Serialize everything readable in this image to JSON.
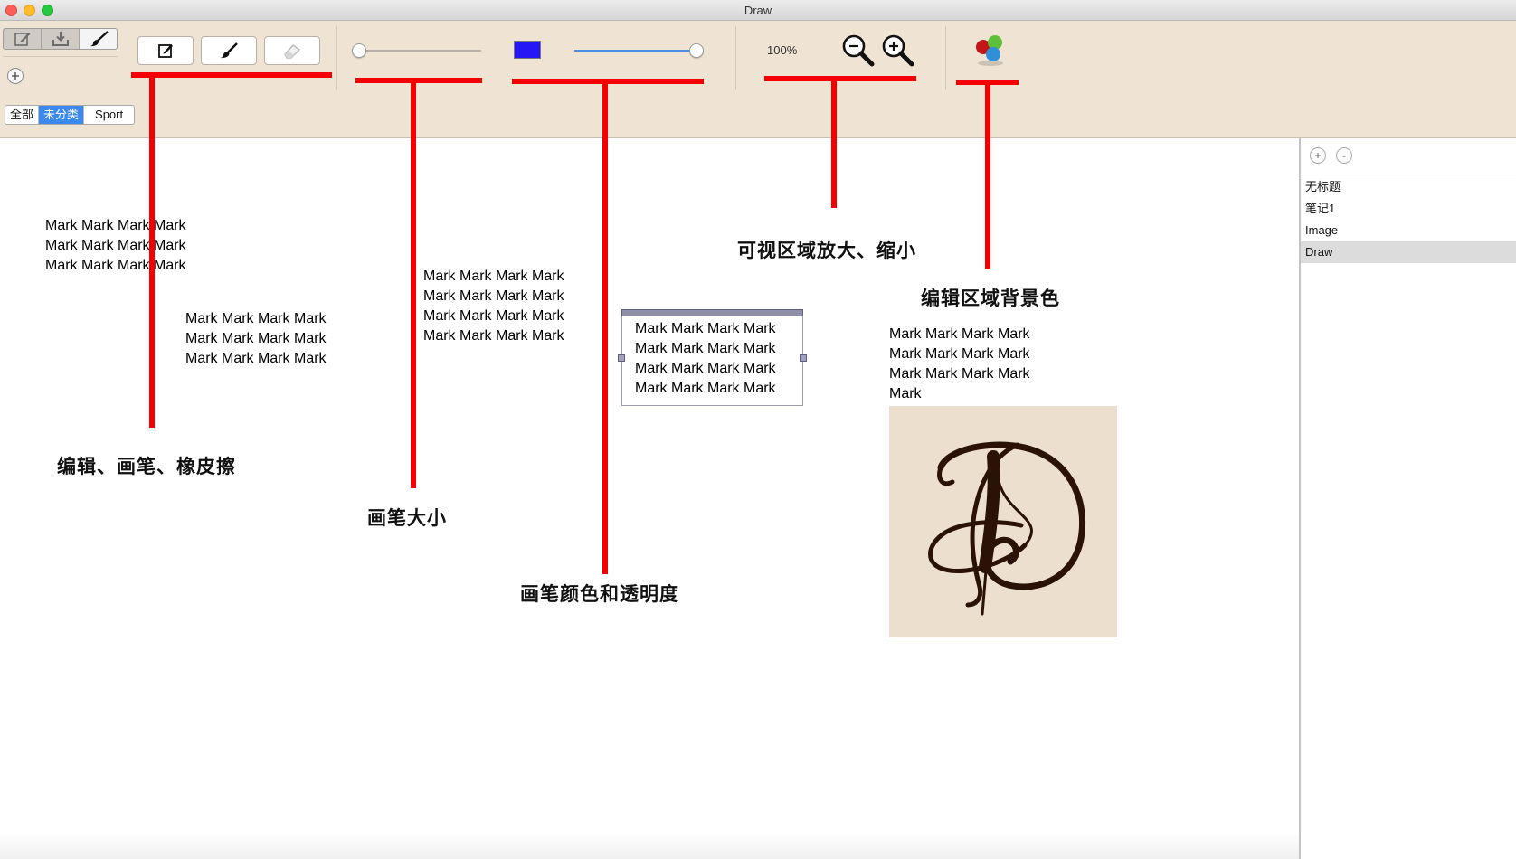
{
  "window": {
    "title": "Draw",
    "controls": [
      "close",
      "minimize",
      "zoom"
    ]
  },
  "toolbar": {
    "mode_buttons": [
      {
        "icon": "note-edit-icon"
      },
      {
        "icon": "download-icon"
      },
      {
        "icon": "paintbrush-icon",
        "selected": true
      }
    ],
    "add_icon": "plus-icon",
    "tool_buttons": [
      {
        "icon": "edit-icon"
      },
      {
        "icon": "brush-icon"
      },
      {
        "icon": "eraser-icon"
      }
    ],
    "brush_size_level": 0.0,
    "brush_color": "#2616f5",
    "brush_opacity_level": 1.0,
    "zoom_text": "100%",
    "zoom_out_icon": "zoom-out-icon",
    "zoom_in_icon": "zoom-in-icon",
    "background_color_icon": "color-palette-icon"
  },
  "categories": {
    "tabs": [
      "全部",
      "未分类",
      "Sport"
    ],
    "active_index": 1
  },
  "canvas": {
    "mark_blocks": [
      {
        "lines": [
          "Mark Mark Mark Mark",
          "Mark Mark Mark Mark",
          "Mark Mark Mark Mark"
        ]
      },
      {
        "lines": [
          "Mark Mark Mark Mark",
          "Mark Mark Mark Mark",
          "Mark Mark Mark Mark"
        ]
      },
      {
        "lines": [
          "Mark Mark Mark Mark",
          "Mark Mark Mark Mark",
          "Mark Mark Mark Mark",
          "Mark Mark Mark Mark"
        ]
      },
      {
        "lines": [
          "Mark Mark Mark Mark",
          "Mark Mark Mark Mark",
          "Mark Mark Mark Mark",
          "Mark Mark Mark Mark"
        ]
      },
      {
        "lines": [
          "Mark Mark Mark Mark",
          "Mark Mark Mark Mark",
          "Mark Mark Mark Mark",
          "Mark"
        ]
      }
    ],
    "annotations": {
      "tools": "编辑、画笔、橡皮擦",
      "brush_size": "画笔大小",
      "brush_color_opacity": "画笔颜色和透明度",
      "zoom": "可视区域放大、缩小",
      "background_color": "编辑区域背景色"
    },
    "annotation_color": "#f40000",
    "image_background": "#ecdfcd",
    "image_ink": "#2b1207"
  },
  "sidebar": {
    "add_label": "+",
    "remove_label": "-",
    "notes": [
      "无标题",
      "笔记1",
      "Image",
      "Draw"
    ],
    "selected_index": 3
  }
}
